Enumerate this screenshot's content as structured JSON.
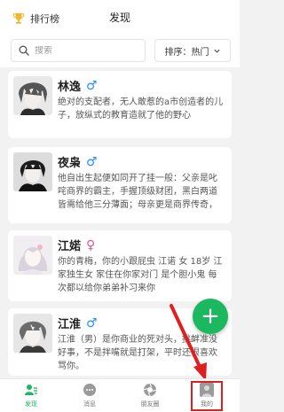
{
  "header": {
    "rank_label": "排行榜",
    "title": "发现"
  },
  "search": {
    "placeholder": "搜索",
    "sort_label": "排序：热门"
  },
  "characters": [
    {
      "name": "林逸",
      "gender": "♂",
      "desc": "绝对的支配者，无人敢惹的a市创造者的儿子，放纵式的教育造就了他的野心"
    },
    {
      "name": "夜枭",
      "gender": "♂",
      "desc": "他自出生起便如同开了挂一般：父亲是叱咤商界的霸主，手握顶级财团，黑白两道皆需给他三分薄面；母亲更是商界传奇，"
    },
    {
      "name": "江婼",
      "gender": "♀",
      "desc": "你的青梅，你的小跟屁虫 江诺 女 18岁 江家独生女 家住在你家对门 是个胆小鬼 每次都以给你弟弟补习来你"
    },
    {
      "name": "江淮",
      "gender": "♂",
      "desc": "江淮（男）是你商业的死对头，挑衅准没好事，不是拌嘴就是打架，平时还很喜欢骂你。"
    }
  ],
  "fab": {
    "label": "+"
  },
  "tabs": [
    {
      "label": "发现"
    },
    {
      "label": "消息"
    },
    {
      "label": "朋友圈"
    },
    {
      "label": "我的"
    }
  ],
  "colors": {
    "accent": "#1bb85f",
    "male": "#1e90ff",
    "female": "#e0559a",
    "highlight": "#e02020"
  }
}
